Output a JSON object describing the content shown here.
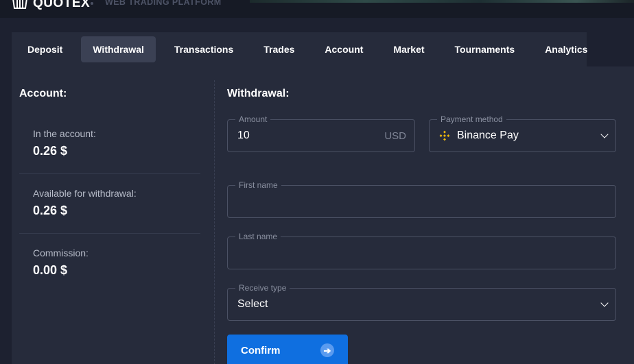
{
  "header": {
    "logo_text": "QUOTEX",
    "subtitle": "WEB TRADING PLATFORM"
  },
  "tabs": [
    {
      "label": "Deposit",
      "active": false
    },
    {
      "label": "Withdrawal",
      "active": true
    },
    {
      "label": "Transactions",
      "active": false
    },
    {
      "label": "Trades",
      "active": false
    },
    {
      "label": "Account",
      "active": false
    },
    {
      "label": "Market",
      "active": false
    },
    {
      "label": "Tournaments",
      "active": false
    },
    {
      "label": "Analytics",
      "active": false
    }
  ],
  "account": {
    "title": "Account:",
    "stats": [
      {
        "label": "In the account:",
        "value": "0.26 $"
      },
      {
        "label": "Available for withdrawal:",
        "value": "0.26 $"
      },
      {
        "label": "Commission:",
        "value": "0.00 $"
      }
    ]
  },
  "withdrawal": {
    "title": "Withdrawal:",
    "amount": {
      "label": "Amount",
      "value": "10",
      "currency": "USD"
    },
    "payment_method": {
      "label": "Payment method",
      "value": "Binance Pay",
      "icon": "binance-icon"
    },
    "first_name": {
      "label": "First name",
      "value": ""
    },
    "last_name": {
      "label": "Last name",
      "value": ""
    },
    "receive_type": {
      "label": "Receive type",
      "value": "Select"
    },
    "confirm_label": "Confirm"
  },
  "colors": {
    "background": "#1d2130",
    "panel": "#262b3b",
    "active_tab": "#3b4154",
    "accent": "#0f6fe0",
    "binance": "#f0b90b"
  }
}
